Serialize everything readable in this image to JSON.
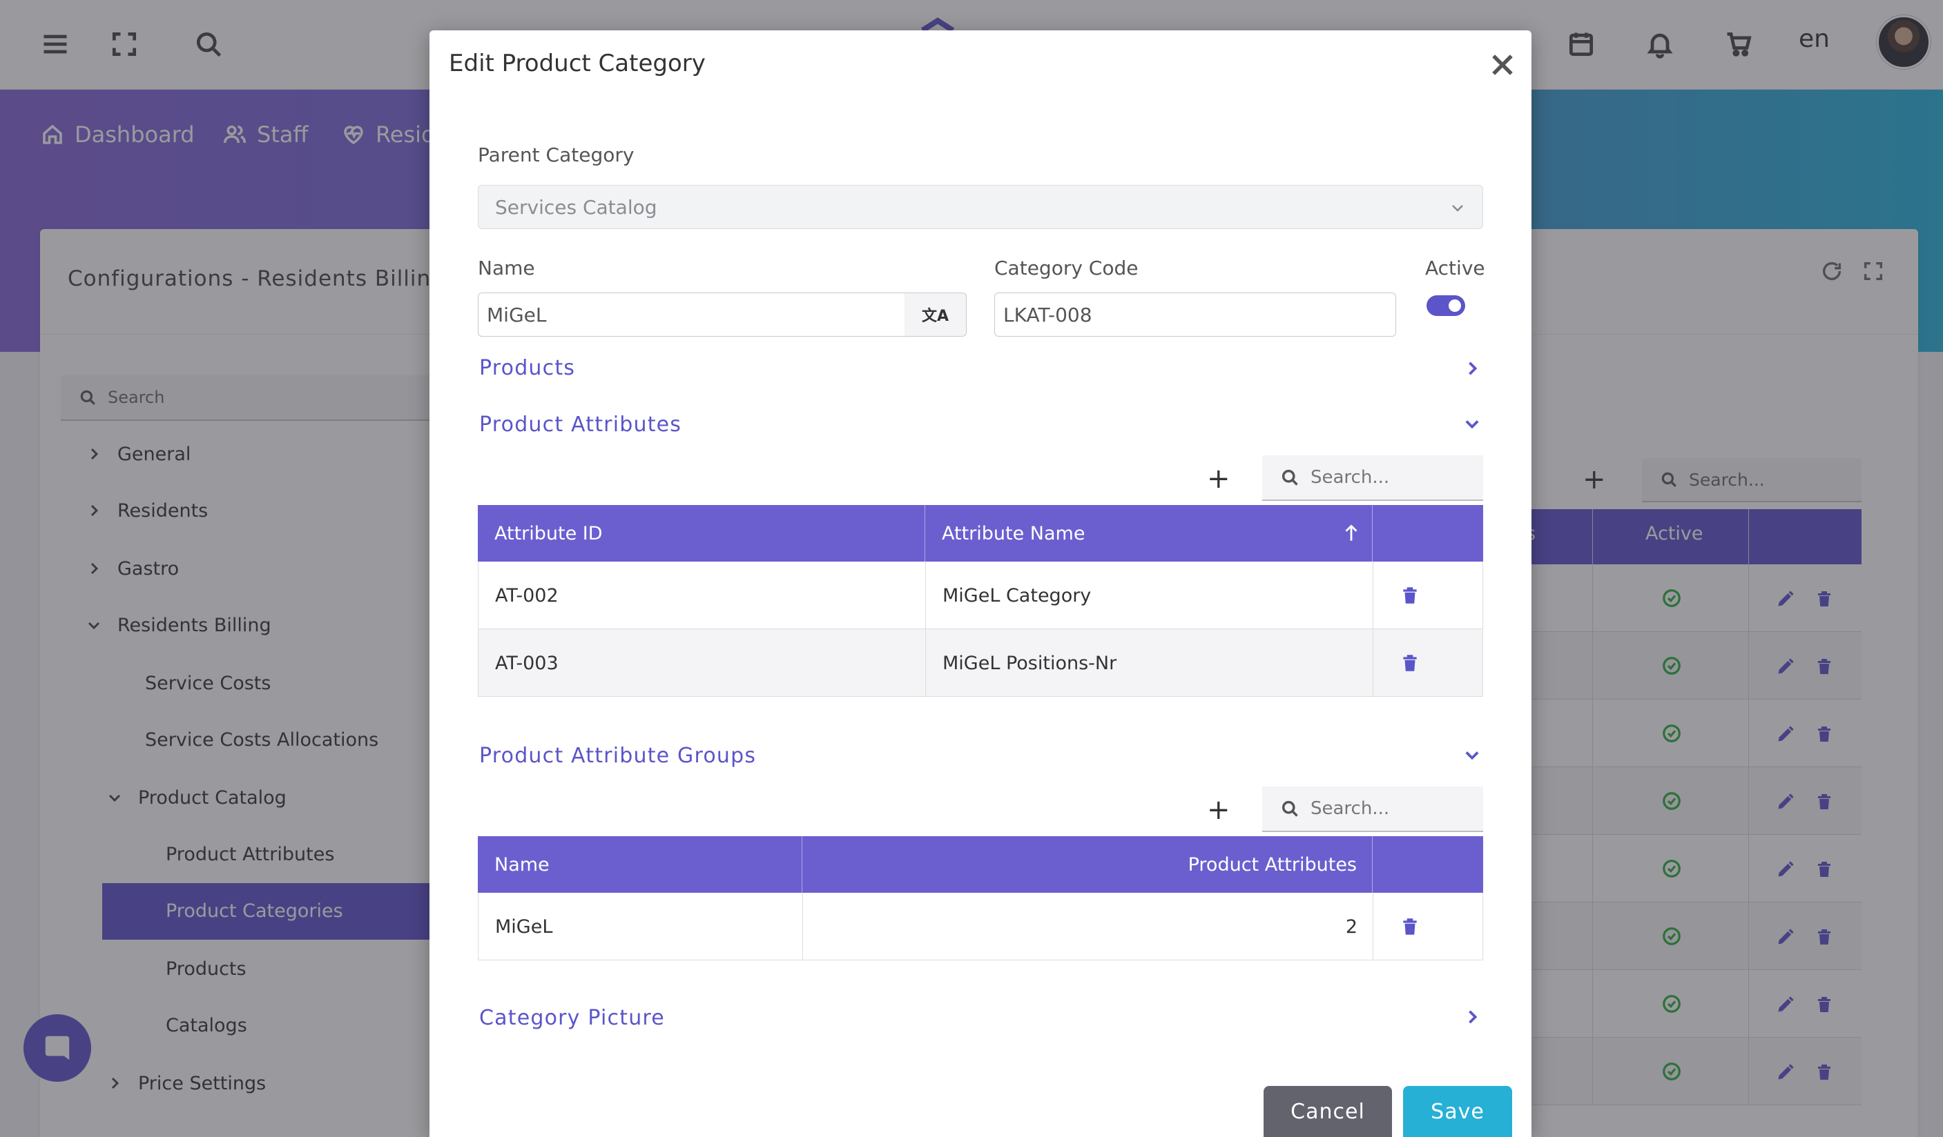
{
  "topbar": {
    "language": "en",
    "icons": [
      "menu-icon",
      "fullscreen-icon",
      "search-icon",
      "calendar-icon",
      "bell-icon",
      "cart-icon"
    ]
  },
  "nav": {
    "items": [
      {
        "label": "Dashboard",
        "icon": "home-icon"
      },
      {
        "label": "Staff",
        "icon": "users-icon"
      },
      {
        "label": "Resid",
        "icon": "heart-pulse-icon"
      }
    ]
  },
  "card": {
    "title": "Configurations  -  Residents Billin"
  },
  "sidebar": {
    "search_placeholder": "Search",
    "items": [
      {
        "label": "General",
        "level": 0,
        "expanded": false
      },
      {
        "label": "Residents",
        "level": 0,
        "expanded": false
      },
      {
        "label": "Gastro",
        "level": 0,
        "expanded": false
      },
      {
        "label": "Residents Billing",
        "level": 0,
        "expanded": true
      },
      {
        "label": "Service Costs",
        "level": 1
      },
      {
        "label": "Service Costs Allocations",
        "level": 1
      },
      {
        "label": "Product Catalog",
        "level": 1,
        "expanded": true
      },
      {
        "label": "Product Attributes",
        "level": 2
      },
      {
        "label": "Product Categories",
        "level": 2,
        "active": true
      },
      {
        "label": "Products",
        "level": 2
      },
      {
        "label": "Catalogs",
        "level": 2
      },
      {
        "label": "Price Settings",
        "level": 1,
        "expanded": false
      }
    ]
  },
  "background_table": {
    "search_placeholder": "Search...",
    "columns": [
      "s",
      "Active"
    ],
    "row_count": 8
  },
  "modal": {
    "title": "Edit Product Category",
    "parent_category_label": "Parent Category",
    "parent_category_value": "Services Catalog",
    "name_label": "Name",
    "name_value": "MiGeL",
    "category_code_label": "Category Code",
    "category_code_value": "LKAT-008",
    "active_label": "Active",
    "active_value": true,
    "products_section": "Products",
    "attributes_section": "Product Attributes",
    "attributes_search_placeholder": "Search...",
    "attributes_table": {
      "columns": [
        "Attribute ID",
        "Attribute Name"
      ],
      "rows": [
        {
          "id": "AT-002",
          "name": "MiGeL Category"
        },
        {
          "id": "AT-003",
          "name": "MiGeL Positions-Nr"
        }
      ]
    },
    "groups_section": "Product Attribute Groups",
    "groups_search_placeholder": "Search...",
    "groups_table": {
      "columns": [
        "Name",
        "Product Attributes"
      ],
      "rows": [
        {
          "name": "MiGeL",
          "count": "2"
        }
      ]
    },
    "picture_section": "Category Picture",
    "cancel_label": "Cancel",
    "save_label": "Save"
  },
  "colors": {
    "accent": "#6b5fcf",
    "link": "#5b55c9",
    "save": "#27b0d6",
    "cancel": "#62636d",
    "active_check": "#3bb54a"
  }
}
